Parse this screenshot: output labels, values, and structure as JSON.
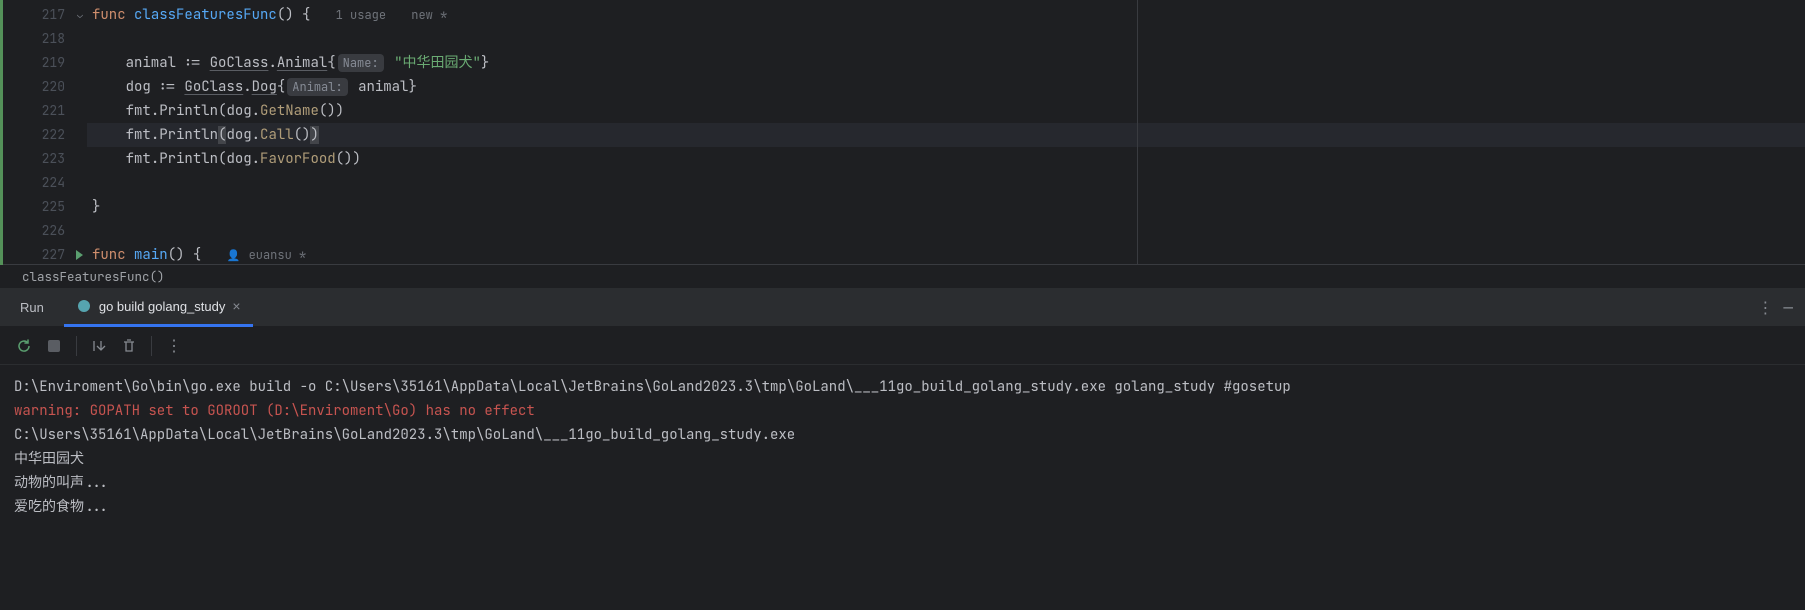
{
  "editor": {
    "lines": {
      "217": {
        "num": "217",
        "func_kw": "func",
        "func_name": "classFeaturesFunc",
        "parens": "()",
        "brace": " {",
        "usage": "1 usage",
        "new": "new *"
      },
      "218": {
        "num": "218"
      },
      "219": {
        "num": "219",
        "indent": "    ",
        "var": "animal",
        "assign": " := ",
        "pkg": "GoClass",
        "dot": ".",
        "type": "Animal",
        "brace_open": "{",
        "hint": "Name:",
        "sp": " ",
        "string": "\"中华田园犬\"",
        "brace_close": "}"
      },
      "220": {
        "num": "220",
        "indent": "    ",
        "var": "dog",
        "assign": " := ",
        "pkg": "GoClass",
        "dot": ".",
        "type": "Dog",
        "brace_open": "{",
        "hint": "Animal:",
        "sp": " ",
        "val": "animal",
        "brace_close": "}"
      },
      "221": {
        "num": "221",
        "indent": "    ",
        "pkg": "fmt",
        "dot": ".",
        "method": "Println",
        "open": "(",
        "arg": "dog",
        "dot2": ".",
        "call": "GetName",
        "parens": "()",
        "close": ")"
      },
      "222": {
        "num": "222",
        "indent": "    ",
        "pkg": "fmt",
        "dot": ".",
        "method": "Println",
        "open": "(",
        "arg": "dog",
        "dot2": ".",
        "call": "Call",
        "parens": "()",
        "close": ")"
      },
      "223": {
        "num": "223",
        "indent": "    ",
        "pkg": "fmt",
        "dot": ".",
        "method": "Println",
        "open": "(",
        "arg": "dog",
        "dot2": ".",
        "call": "FavorFood",
        "parens": "()",
        "close": ")"
      },
      "224": {
        "num": "224"
      },
      "225": {
        "num": "225",
        "brace": "}"
      },
      "226": {
        "num": "226"
      },
      "227": {
        "num": "227",
        "func_kw": "func",
        "func_name": "main",
        "parens": "()",
        "brace": " {",
        "author": "euansu *"
      }
    }
  },
  "breadcrumb": "classFeaturesFunc()",
  "run": {
    "label": "Run",
    "tab_label": "go build golang_study"
  },
  "console": {
    "line1": "D:\\Enviroment\\Go\\bin\\go.exe build -o C:\\Users\\35161\\AppData\\Local\\JetBrains\\GoLand2023.3\\tmp\\GoLand\\___11go_build_golang_study.exe golang_study #gosetup",
    "line2": "warning: GOPATH set to GOROOT (D:\\Enviroment\\Go) has no effect",
    "line3": "C:\\Users\\35161\\AppData\\Local\\JetBrains\\GoLand2023.3\\tmp\\GoLand\\___11go_build_golang_study.exe",
    "line4": "中华田园犬",
    "line5": "动物的叫声...",
    "line6": "爱吃的食物..."
  }
}
